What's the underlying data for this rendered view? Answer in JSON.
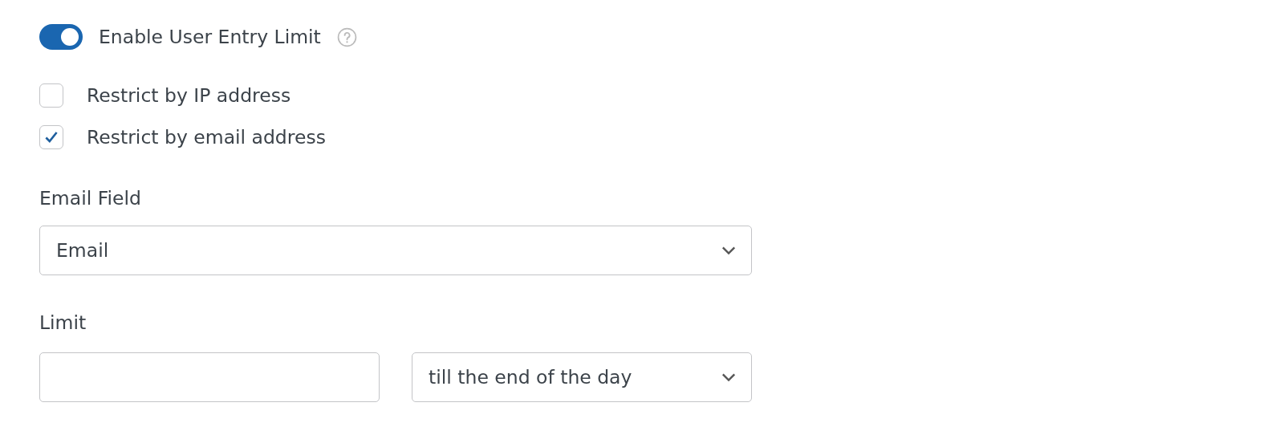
{
  "toggle": {
    "label": "Enable User Entry Limit",
    "on": true
  },
  "options": [
    {
      "label": "Restrict by IP address",
      "checked": false
    },
    {
      "label": "Restrict by email address",
      "checked": true
    }
  ],
  "email_field": {
    "label": "Email Field",
    "value": "Email"
  },
  "limit": {
    "label": "Limit",
    "period": "till the end of the day"
  }
}
